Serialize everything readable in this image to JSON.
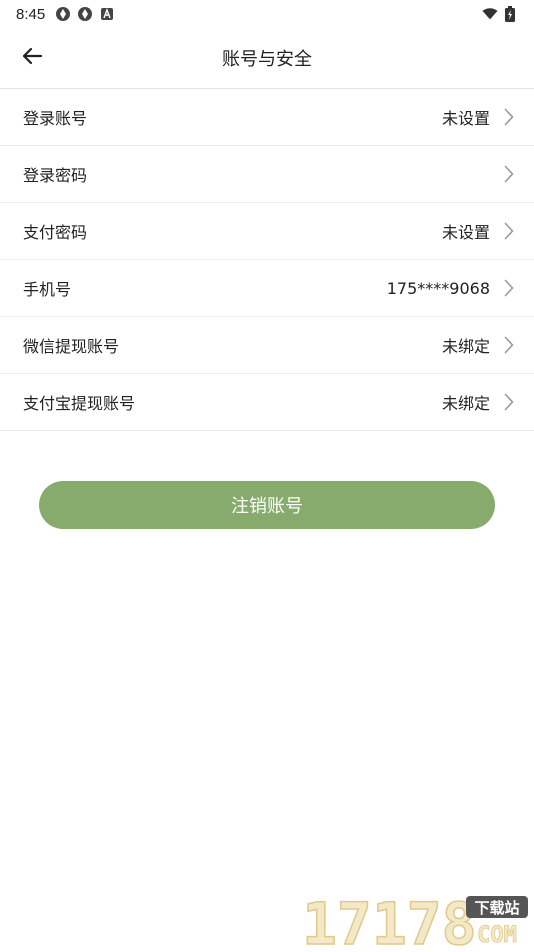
{
  "status_bar": {
    "time": "8:45",
    "icons": [
      "app-notification-icon",
      "app-notification-icon",
      "font-a-icon"
    ],
    "right_icons": [
      "wifi-icon",
      "battery-charging-icon"
    ]
  },
  "header": {
    "title": "账号与安全",
    "back_icon": "arrow-left-icon"
  },
  "rows": [
    {
      "label": "登录账号",
      "value": "未设置"
    },
    {
      "label": "登录密码",
      "value": ""
    },
    {
      "label": "支付密码",
      "value": "未设置"
    },
    {
      "label": "手机号",
      "value": "175****9068"
    },
    {
      "label": "微信提现账号",
      "value": "未绑定"
    },
    {
      "label": "支付宝提现账号",
      "value": "未绑定"
    }
  ],
  "delete_button": {
    "label": "注销账号",
    "color": "#86ab6c"
  },
  "watermark": {
    "number": "17178",
    "tag": "下载站",
    "domain": "COM"
  }
}
